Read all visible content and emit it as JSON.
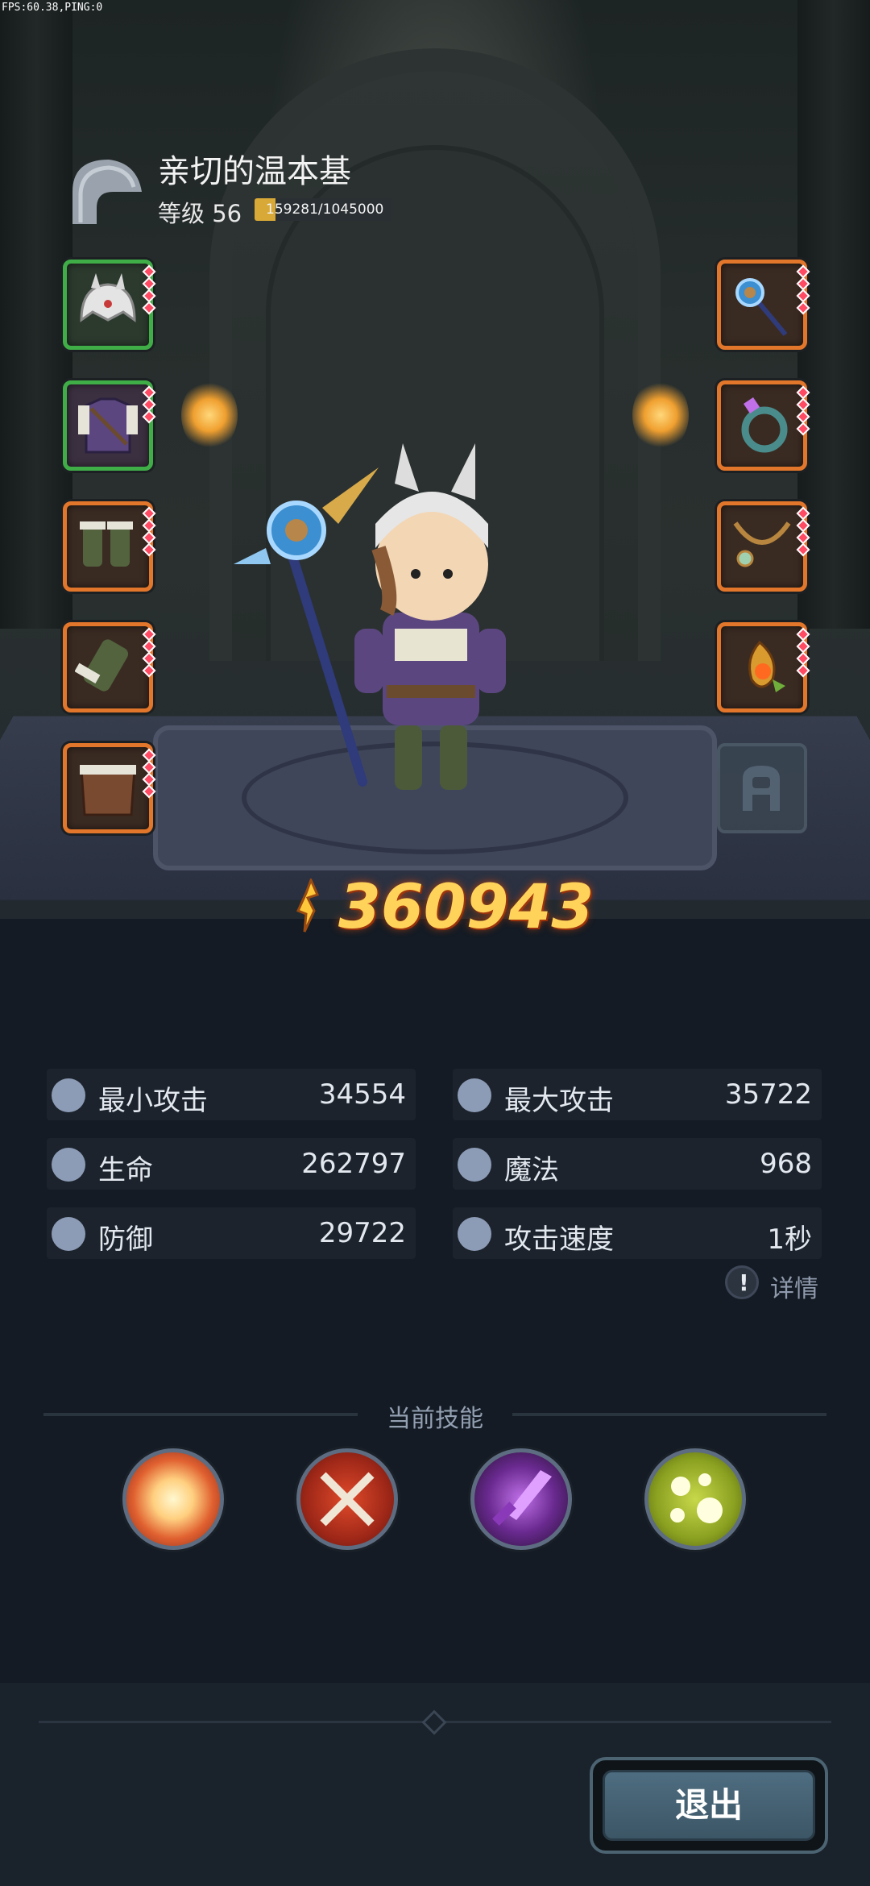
{
  "debug": {
    "fps_text": "FPS:60.38,PING:0"
  },
  "player": {
    "name": "亲切的温本基",
    "level_label": "等级 56",
    "xp_text": "159281/1045000",
    "xp_fraction": 0.152
  },
  "power": {
    "value": "360943"
  },
  "equipment": {
    "left": [
      "helmet",
      "armor",
      "boots",
      "gloves",
      "belt"
    ],
    "right": [
      "staff",
      "ring",
      "necklace",
      "amulet"
    ],
    "locked_slot": "costume"
  },
  "stats": {
    "min_attack": {
      "label": "最小攻击",
      "value": "34554"
    },
    "max_attack": {
      "label": "最大攻击",
      "value": "35722"
    },
    "hp": {
      "label": "生命",
      "value": "262797"
    },
    "mana": {
      "label": "魔法",
      "value": "968"
    },
    "defense": {
      "label": "防御",
      "value": "29722"
    },
    "attack_speed": {
      "label": "攻击速度",
      "value": "1秒"
    }
  },
  "details_label": "详情",
  "skills": {
    "title": "当前技能",
    "items": [
      "explosion-skill",
      "crossed-axes-skill",
      "shadow-strike-skill",
      "poison-bubbles-skill"
    ]
  },
  "exit_label": "退出",
  "colors": {
    "background": "#141b24",
    "rarity_orange": "#e2762a",
    "rarity_green": "#3fae47",
    "power_gold": "#ffd25a"
  }
}
